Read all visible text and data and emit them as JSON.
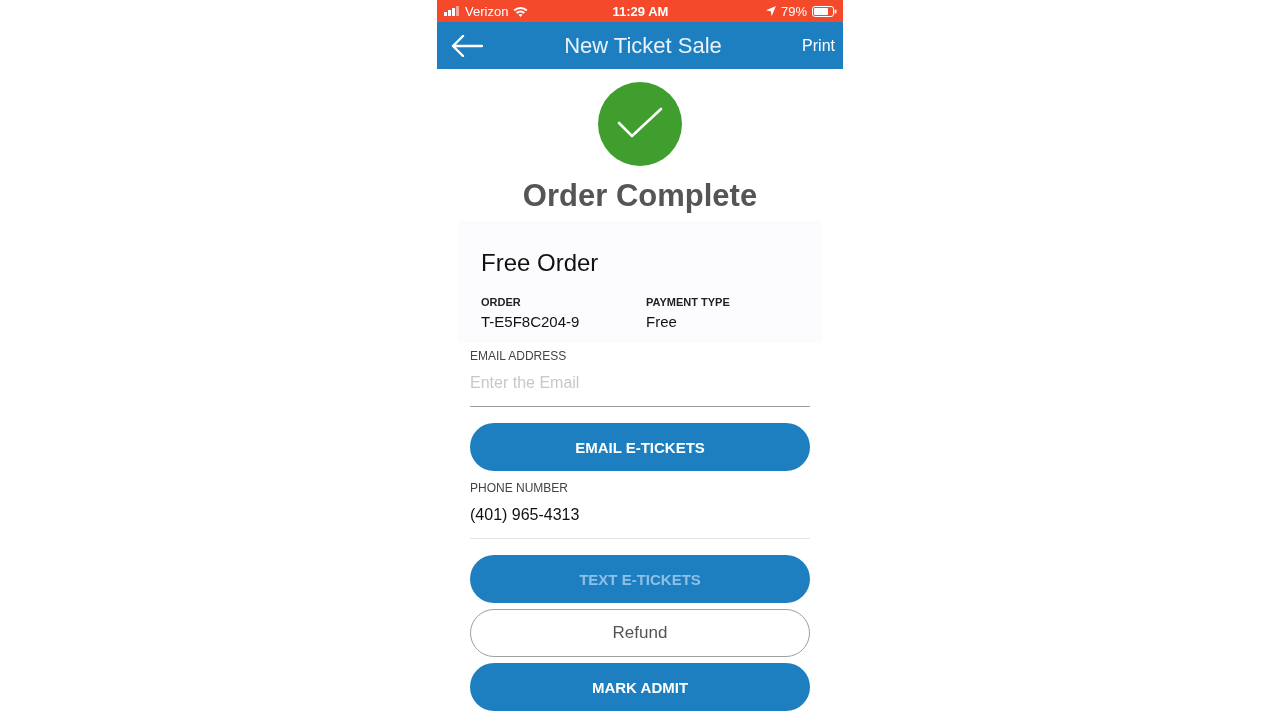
{
  "status_bar": {
    "carrier": "Verizon",
    "time": "11:29 AM",
    "battery": "79%"
  },
  "nav_bar": {
    "title": "New Ticket Sale",
    "action": "Print"
  },
  "heading": "Order Complete",
  "order_card": {
    "title": "Free Order",
    "fields": [
      {
        "label": "ORDER",
        "value": "T-E5F8C204-9"
      },
      {
        "label": "PAYMENT TYPE",
        "value": "Free"
      }
    ]
  },
  "form": [
    {
      "kind": "field",
      "label": "EMAIL ADDRESS",
      "placeholder": "Enter the Email",
      "focused": true
    },
    {
      "kind": "filled",
      "label": "EMAIL E-TICKETS",
      "disabled": false
    },
    {
      "kind": "field",
      "label": "PHONE NUMBER",
      "value": "(401) 965-4313",
      "focused": false
    },
    {
      "kind": "filled",
      "label": "TEXT E-TICKETS",
      "disabled": true
    },
    {
      "kind": "outline",
      "label": "Refund",
      "disabled": false
    },
    {
      "kind": "filled",
      "label": "MARK ADMIT",
      "disabled": false
    }
  ]
}
